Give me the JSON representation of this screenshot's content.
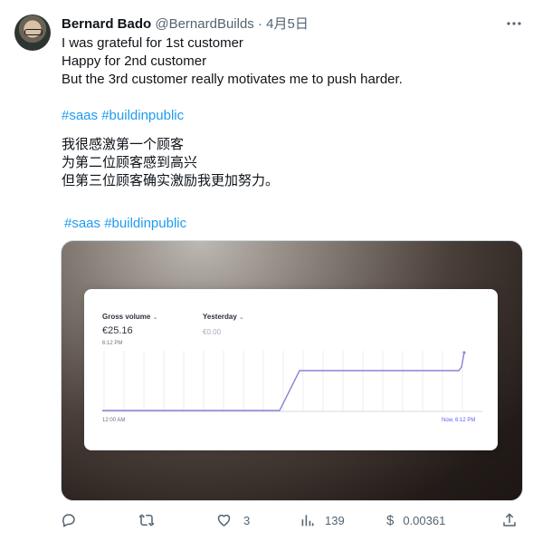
{
  "tweet": {
    "author_name": "Bernard Bado",
    "handle": "@BernardBuilds",
    "separator": "·",
    "date": "4月5日",
    "more_icon": "more-icon",
    "body_lines_en": [
      "I was grateful for 1st customer",
      "Happy for 2nd customer",
      "But the 3rd customer really motivates me to push harder."
    ],
    "hashtags_1": [
      "#saas",
      "#buildinpublic"
    ],
    "body_lines_zh": [
      "我很感激第一个顾客",
      "为第二位顾客感到高兴",
      "但第三位顾客确实激励我更加努力。"
    ],
    "hashtags_2": [
      "#saas",
      "#buildinpublic"
    ]
  },
  "dashboard": {
    "gross_volume_label": "Gross volume",
    "gross_volume_value": "€25.16",
    "gross_volume_time": "6:12 PM",
    "yesterday_label": "Yesterday",
    "yesterday_value": "€0.00",
    "axis_start": "12:00 AM",
    "axis_end": "Now, 6:12 PM",
    "line_color": "#8b84d7"
  },
  "actions": {
    "reply_icon": "reply-icon",
    "retweet_icon": "retweet-icon",
    "like_icon": "heart-icon",
    "like_count": "3",
    "views_icon": "views-icon",
    "views_count": "139",
    "tip_icon": "dollar-icon",
    "tip_value": "0.00361",
    "share_icon": "share-icon"
  }
}
